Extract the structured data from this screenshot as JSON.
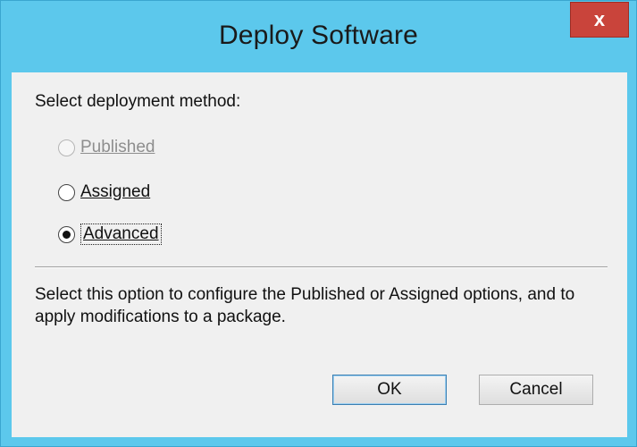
{
  "window": {
    "title": "Deploy Software",
    "close_glyph": "x"
  },
  "dialog": {
    "prompt": "Select deployment method:",
    "options": [
      {
        "label": "Published",
        "state": "disabled",
        "selected": false
      },
      {
        "label": "Assigned",
        "state": "enabled",
        "selected": false
      },
      {
        "label": "Advanced",
        "state": "enabled",
        "selected": true
      }
    ],
    "description": "Select this option to configure the Published or Assigned options, and to apply modifications to a package."
  },
  "buttons": {
    "ok_label": "OK",
    "cancel_label": "Cancel"
  },
  "colors": {
    "titlebar": "#5cc8ec",
    "close_button": "#c9443b",
    "client_background": "#f0f0f0"
  },
  "icons": {
    "close": "close-icon"
  }
}
